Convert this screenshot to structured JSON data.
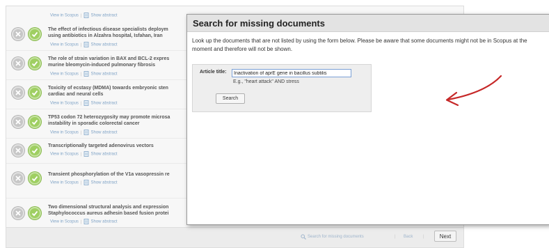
{
  "results": {
    "view_in_scopus": "View in Scopus",
    "separator": "|",
    "show_abstract": "Show abstract",
    "items": [
      {
        "title_line1": "The effect of infectious disease specialists deploym",
        "title_line2": "using antibiotics in Alzahra hospital, Isfahan, Iran"
      },
      {
        "title_line1": "The role of strain variation in BAX and BCL-2 expres",
        "title_line2": "murine bleomycin-induced pulmonary fibrosis"
      },
      {
        "title_line1": "Toxicity of ecstasy (MDMA) towards embryonic sten",
        "title_line2": "cardiac and neural cells"
      },
      {
        "title_line1": "TP53 codon 72 heterozygosity may promote microsa",
        "title_line2": "instability in sporadic colorectal cancer"
      },
      {
        "title_line1": "Transcriptionally targeted adenovirus vectors",
        "title_line2": ""
      },
      {
        "title_line1": "Transient phosphorylation of the V1a vasopressin re",
        "title_line2": ""
      },
      {
        "title_line1": "Two dimensional structural analysis and expression",
        "title_line2": "Staphylococcus aureus adhesin based fusion protei"
      }
    ]
  },
  "footer": {
    "search_missing": "Search for missing documents",
    "back": "Back",
    "separator": "|",
    "next": "Next"
  },
  "dialog": {
    "title": "Search for missing documents",
    "description": "Look up the documents that are not listed by using the form below. Please be aware that some documents might not be in Scopus at the moment and therefore will not be shown.",
    "field_label": "Article title:",
    "field_value": "Inactivation of aprE gene in bacillus subtilis",
    "hint": "E.g., \"heart attack\" AND stress",
    "search_button": "Search"
  },
  "colors": {
    "accept": "#9fcf62",
    "reject": "#c7c7c7",
    "link": "#7fa3c6",
    "arrow": "#c62828"
  },
  "icons": {
    "reject": "x-icon",
    "accept": "check-icon",
    "abstract": "document-icon",
    "search": "magnifier-icon"
  }
}
